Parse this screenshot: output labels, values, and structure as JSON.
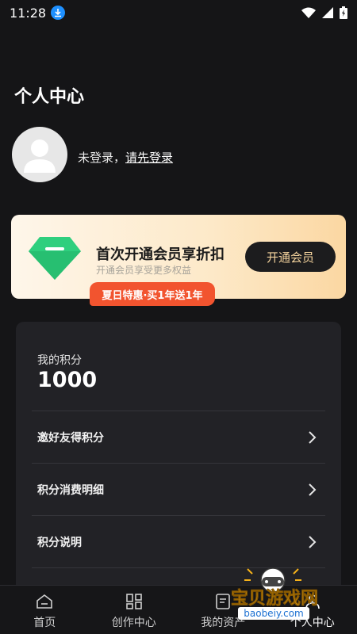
{
  "status": {
    "time": "11:28"
  },
  "page": {
    "title": "个人中心"
  },
  "login": {
    "prefix": "未登录，",
    "link": "请先登录"
  },
  "vip": {
    "title": "首次开通会员享折扣",
    "subtitle": "开通会员享受更多权益",
    "button": "开通会员",
    "promo": "夏日特惠·买1年送1年"
  },
  "points": {
    "label": "我的积分",
    "value": "1000",
    "menu": [
      {
        "label": "邀好友得积分"
      },
      {
        "label": "积分消费明细"
      },
      {
        "label": "积分说明"
      }
    ]
  },
  "tabs": [
    {
      "label": "首页"
    },
    {
      "label": "创作中心"
    },
    {
      "label": "我的资产"
    },
    {
      "label": "个人中心"
    }
  ],
  "watermark": {
    "title": "宝贝游戏网",
    "url": "baobeiy.com"
  },
  "colors": {
    "accent": "#f4d39d",
    "promo": "#f2542f",
    "diamond": "#2fcf7e"
  }
}
